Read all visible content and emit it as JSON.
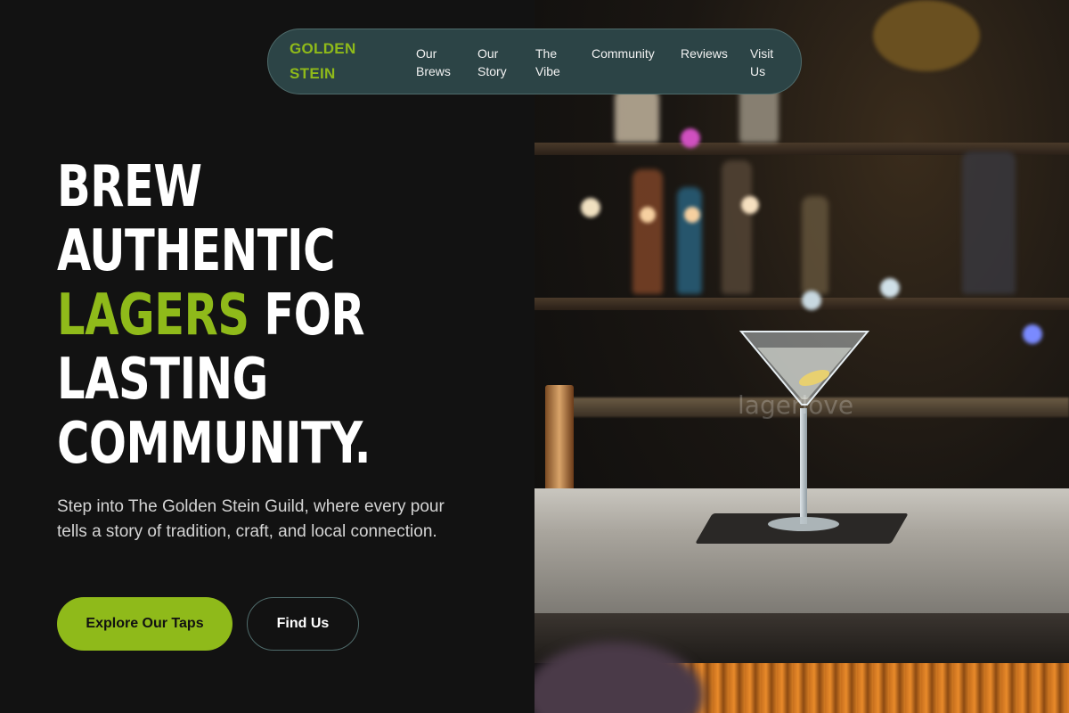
{
  "nav": {
    "logo_line1": "GOLDEN",
    "logo_line2": "STEIN",
    "links": [
      {
        "line1": "Our",
        "line2": "Brews"
      },
      {
        "line1": "Our",
        "line2": "Story"
      },
      {
        "line1": "The",
        "line2": "Vibe"
      },
      {
        "line1": "Community",
        "line2": ""
      },
      {
        "line1": "Reviews",
        "line2": ""
      },
      {
        "line1": "Visit",
        "line2": "Us"
      }
    ]
  },
  "hero": {
    "line1": "BREW",
    "line2": "AUTHENTIC",
    "line3_accent": "LAGERS",
    "line3_rest": " FOR",
    "line4": "LASTING",
    "line5": "COMMUNITY.",
    "subtitle": "Step into The Golden Stein Guild, where every pour tells a story of tradition, craft, and local connection.",
    "primary_button": "Explore Our Taps",
    "secondary_button": "Find Us"
  },
  "image": {
    "watermark": "lagerlove"
  },
  "colors": {
    "accent": "#8fba1a",
    "background": "#121212",
    "nav_background": "#2c4446"
  }
}
